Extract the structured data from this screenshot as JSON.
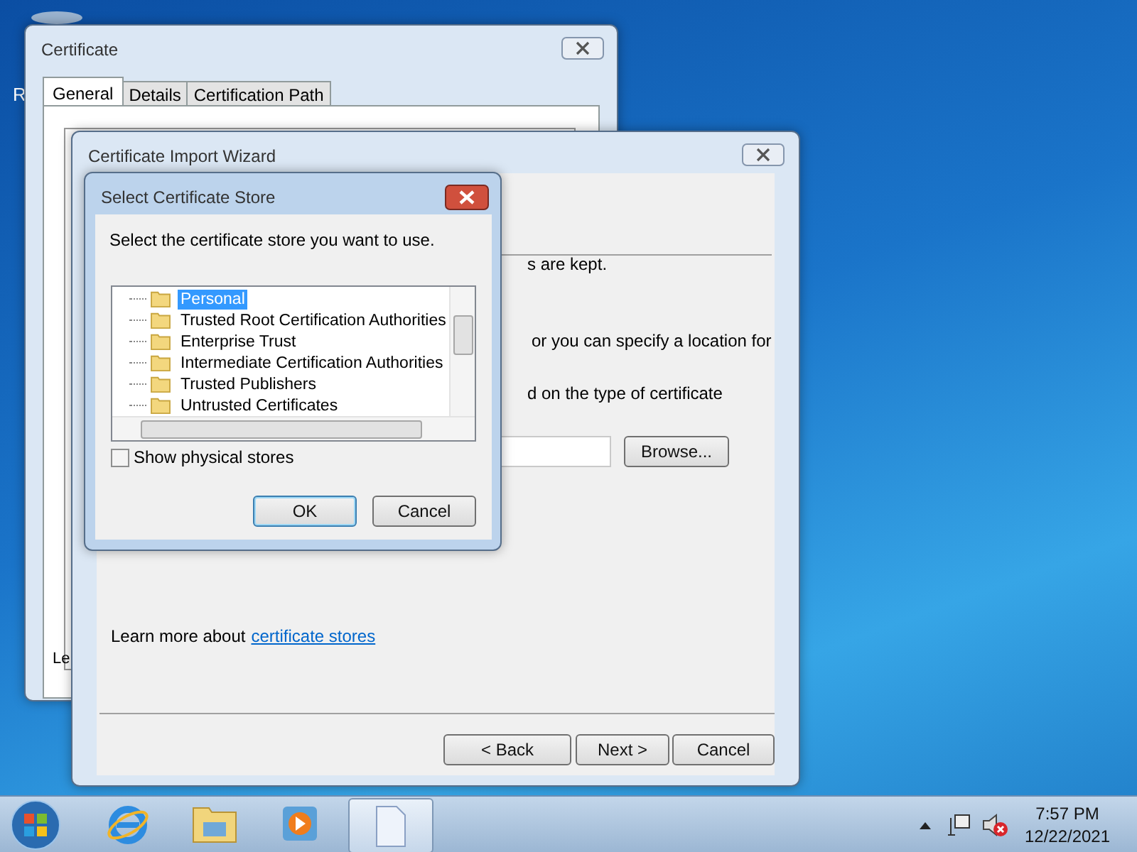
{
  "desktop": {
    "icon_label": "R"
  },
  "certificate_window": {
    "title": "Certificate",
    "tabs": [
      {
        "label": "General",
        "selected": true
      },
      {
        "label": "Details",
        "selected": false
      },
      {
        "label": "Certification Path",
        "selected": false
      }
    ],
    "footer_text": "Le"
  },
  "wizard": {
    "title": "Certificate Import Wizard",
    "text_fragments": [
      "s are kept.",
      "or you can specify a location for",
      "d on the type of certificate"
    ],
    "browse_button": "Browse...",
    "learn_more": {
      "text": "Learn more about",
      "link": "certificate stores"
    },
    "buttons": [
      {
        "label": "< Back",
        "default": false
      },
      {
        "label": "Next >",
        "default": false
      },
      {
        "label": "Cancel",
        "default": false
      }
    ]
  },
  "store_dialog": {
    "title": "Select Certificate Store",
    "instruction": "Select the certificate store you want to use.",
    "stores": [
      {
        "label": "Personal",
        "selected": true
      },
      {
        "label": "Trusted Root Certification Authorities",
        "selected": false
      },
      {
        "label": "Enterprise Trust",
        "selected": false
      },
      {
        "label": "Intermediate Certification Authorities",
        "selected": false
      },
      {
        "label": "Trusted Publishers",
        "selected": false
      },
      {
        "label": "Untrusted Certificates",
        "selected": false
      }
    ],
    "show_physical_stores": {
      "label": "Show physical stores",
      "checked": false
    },
    "buttons": [
      {
        "label": "OK",
        "default": true
      },
      {
        "label": "Cancel",
        "default": false
      }
    ]
  },
  "taskbar": {
    "time": "7:57 PM",
    "date": "12/22/2021"
  }
}
